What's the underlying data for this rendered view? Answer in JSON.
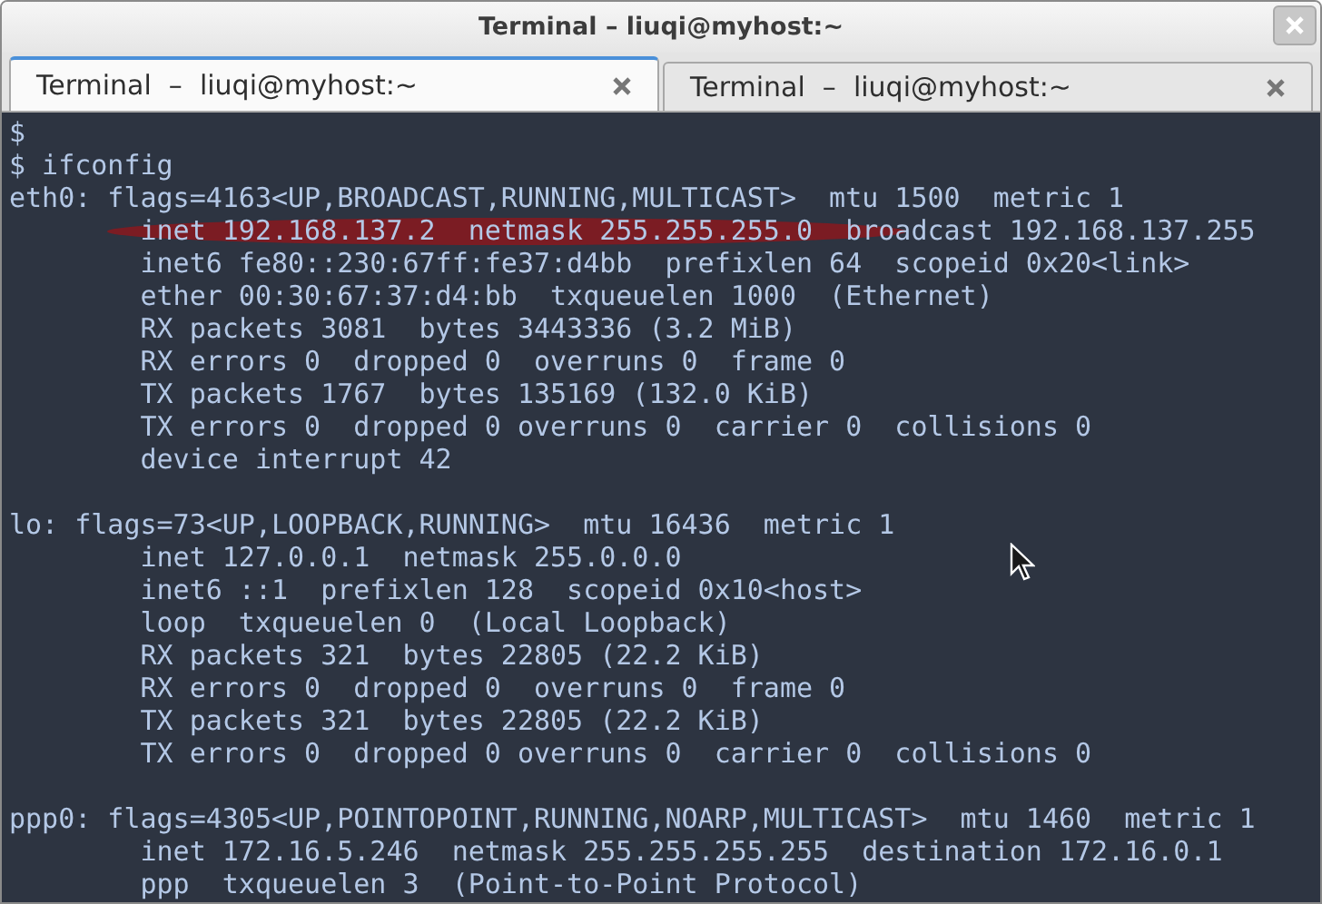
{
  "window": {
    "title": "Terminal – liuqi@myhost:~"
  },
  "tabs": [
    {
      "label": "Terminal  –  liuqi@myhost:~",
      "selected": true
    },
    {
      "label": "Terminal  –  liuqi@myhost:~",
      "selected": false
    }
  ],
  "terminal": {
    "prompt_lines": [
      "$",
      "$ ifconfig"
    ],
    "interfaces": [
      {
        "lines": [
          {
            "text": "eth0: flags=4163<UP,BROADCAST,RUNNING,MULTICAST>  mtu 1500  metric 1",
            "marked": false
          },
          {
            "text": "        inet 192.168.137.2  netmask 255.255.255.0  broadcast 192.168.137.255",
            "marked": true
          },
          {
            "text": "        inet6 fe80::230:67ff:fe37:d4bb  prefixlen 64  scopeid 0x20<link>",
            "marked": false
          },
          {
            "text": "        ether 00:30:67:37:d4:bb  txqueuelen 1000  (Ethernet)",
            "marked": false
          },
          {
            "text": "        RX packets 3081  bytes 3443336 (3.2 MiB)",
            "marked": false
          },
          {
            "text": "        RX errors 0  dropped 0  overruns 0  frame 0",
            "marked": false
          },
          {
            "text": "        TX packets 1767  bytes 135169 (132.0 KiB)",
            "marked": false
          },
          {
            "text": "        TX errors 0  dropped 0 overruns 0  carrier 0  collisions 0",
            "marked": false
          },
          {
            "text": "        device interrupt 42",
            "marked": false
          }
        ]
      },
      {
        "lines": [
          {
            "text": "lo: flags=73<UP,LOOPBACK,RUNNING>  mtu 16436  metric 1",
            "marked": false
          },
          {
            "text": "        inet 127.0.0.1  netmask 255.0.0.0",
            "marked": false
          },
          {
            "text": "        inet6 ::1  prefixlen 128  scopeid 0x10<host>",
            "marked": false
          },
          {
            "text": "        loop  txqueuelen 0  (Local Loopback)",
            "marked": false
          },
          {
            "text": "        RX packets 321  bytes 22805 (22.2 KiB)",
            "marked": false
          },
          {
            "text": "        RX errors 0  dropped 0  overruns 0  frame 0",
            "marked": false
          },
          {
            "text": "        TX packets 321  bytes 22805 (22.2 KiB)",
            "marked": false
          },
          {
            "text": "        TX errors 0  dropped 0 overruns 0  carrier 0  collisions 0",
            "marked": false
          }
        ]
      },
      {
        "lines": [
          {
            "text": "ppp0: flags=4305<UP,POINTOPOINT,RUNNING,NOARP,MULTICAST>  mtu 1460  metric 1",
            "marked": false
          },
          {
            "text": "        inet 172.16.5.246  netmask 255.255.255.255  destination 172.16.0.1",
            "marked": false
          },
          {
            "text": "        ppp  txqueuelen 3  (Point-to-Point Protocol)",
            "marked": false
          }
        ]
      }
    ]
  }
}
